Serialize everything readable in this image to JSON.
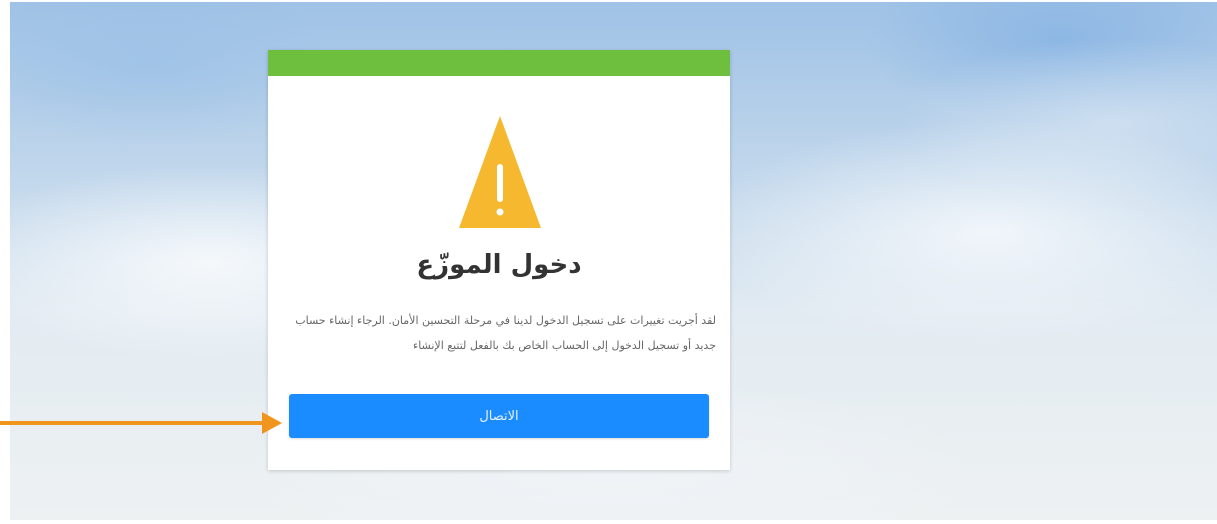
{
  "dialog": {
    "title": "دخول الموزّع",
    "message": "لقد أجريت تغييرات على تسجيل الدخول لدينا في مرحلة التحسين الأمان. الرجاء إنشاء حساب جديد أو تسجيل الدخول إلى الحساب الخاص بك بالفعل لتتبع الإنشاء",
    "button_label": "الاتصال"
  },
  "icons": {
    "warning": "warning-triangle-icon",
    "pointer": "arrow-right-icon"
  },
  "colors": {
    "header_bar": "#6fbf3f",
    "warning": "#f5b82e",
    "button": "#1a8cff",
    "annotation_arrow": "#f0961e"
  }
}
